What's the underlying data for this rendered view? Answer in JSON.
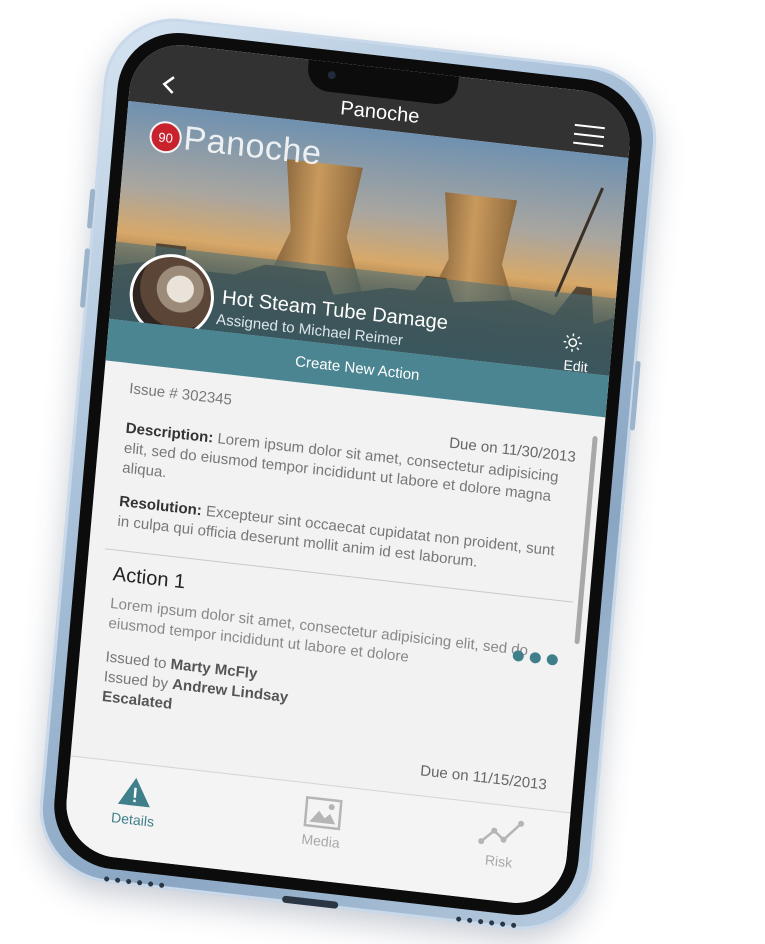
{
  "navbar": {
    "title": "Panoche",
    "back_icon": "chevron-left-icon",
    "menu_icon": "hamburger-menu-icon"
  },
  "hero": {
    "score": "90",
    "site_name": "Panoche",
    "issue_title": "Hot Steam Tube Damage",
    "assigned": "Assigned to Michael Reimer",
    "edit_label": "Edit",
    "edit_icon": "gear-icon"
  },
  "create_action_label": "Create New Action",
  "issue": {
    "number": "Issue # 302345",
    "due": "Due on 11/30/2013",
    "description_label": "Description:",
    "description": "Lorem ipsum dolor sit amet, consectetur adipisicing elit, sed do eiusmod tempor incididunt ut labore et dolore magna aliqua.",
    "resolution_label": "Resolution:",
    "resolution": "Excepteur sint occaecat cupidatat non proident, sunt in culpa qui officia deserunt mollit anim id est laborum."
  },
  "action": {
    "title": "Action 1",
    "description": "Lorem ipsum dolor sit amet, consectetur adipisicing elit, sed do eiusmod tempor incididunt ut labore et dolore",
    "issued_to_label": "Issued to",
    "issued_to": "Marty McFly",
    "issued_by_label": "Issued by",
    "issued_by": "Andrew Lindsay",
    "status": "Escalated",
    "due": "Due on 11/15/2013"
  },
  "tabs": [
    {
      "label": "Details",
      "icon": "warning-triangle-icon",
      "active": true
    },
    {
      "label": "Media",
      "icon": "image-icon",
      "active": false
    },
    {
      "label": "Risk",
      "icon": "line-chart-icon",
      "active": false
    }
  ],
  "colors": {
    "accent": "#4a8591",
    "badge": "#c8222d",
    "navbar": "#323233"
  }
}
